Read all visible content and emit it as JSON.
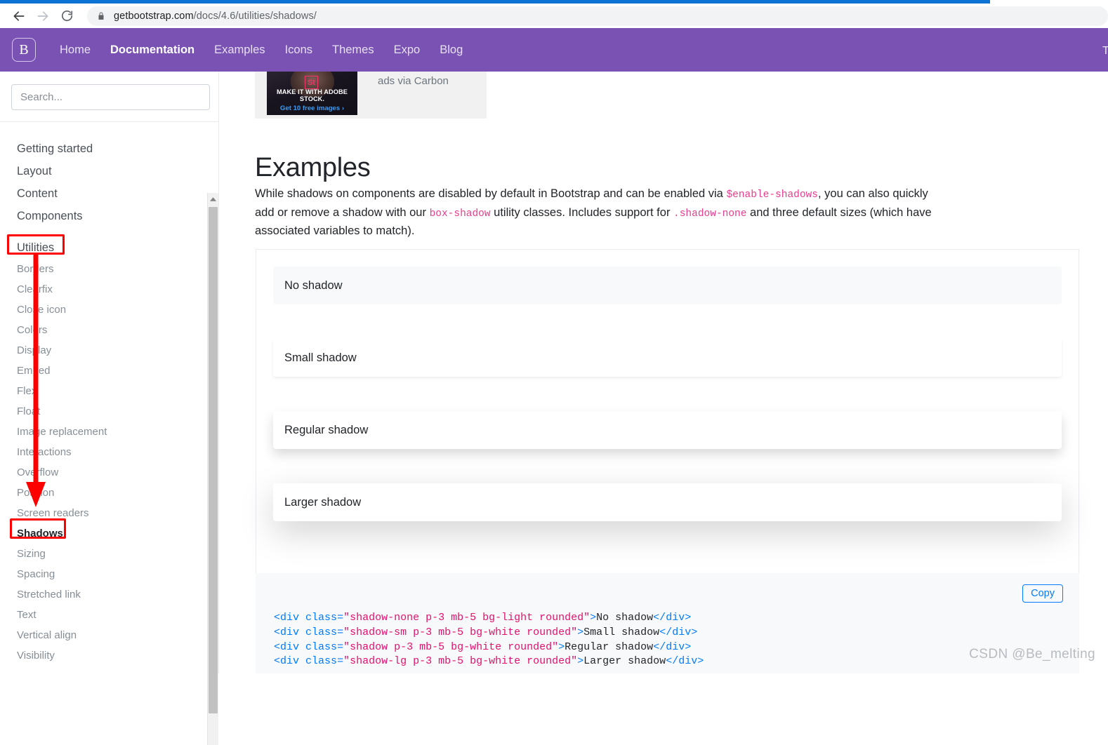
{
  "browser": {
    "back_icon": "arrow-left-icon",
    "forward_icon": "arrow-right-icon",
    "reload_icon": "reload-icon",
    "lock_icon": "lock-icon",
    "url_host": "getbootstrap.com",
    "url_path": "/docs/4.6/utilities/shadows/",
    "tab_strip_color": "#0c72d4"
  },
  "navbar": {
    "brand": "B",
    "brand_color": "#7952b3",
    "links": [
      {
        "label": "Home",
        "active": false
      },
      {
        "label": "Documentation",
        "active": true
      },
      {
        "label": "Examples",
        "active": false
      },
      {
        "label": "Icons",
        "active": false
      },
      {
        "label": "Themes",
        "active": false
      },
      {
        "label": "Expo",
        "active": false
      },
      {
        "label": "Blog",
        "active": false
      }
    ]
  },
  "sidebar": {
    "search_placeholder": "Search...",
    "search_value": "",
    "groups": [
      {
        "label": "Getting started"
      },
      {
        "label": "Layout"
      },
      {
        "label": "Content"
      },
      {
        "label": "Components"
      },
      {
        "label": "Utilities"
      }
    ],
    "utilities_items": [
      {
        "label": "Borders",
        "current": false
      },
      {
        "label": "Clearfix",
        "current": false
      },
      {
        "label": "Close icon",
        "current": false
      },
      {
        "label": "Colors",
        "current": false
      },
      {
        "label": "Display",
        "current": false
      },
      {
        "label": "Embed",
        "current": false
      },
      {
        "label": "Flex",
        "current": false
      },
      {
        "label": "Float",
        "current": false
      },
      {
        "label": "Image replacement",
        "current": false
      },
      {
        "label": "Interactions",
        "current": false
      },
      {
        "label": "Overflow",
        "current": false
      },
      {
        "label": "Position",
        "current": false
      },
      {
        "label": "Screen readers",
        "current": false
      },
      {
        "label": "Shadows",
        "current": true
      },
      {
        "label": "Sizing",
        "current": false
      },
      {
        "label": "Spacing",
        "current": false
      },
      {
        "label": "Stretched link",
        "current": false
      },
      {
        "label": "Text",
        "current": false
      },
      {
        "label": "Vertical align",
        "current": false
      },
      {
        "label": "Visibility",
        "current": false
      }
    ]
  },
  "ad": {
    "headline": "MAKE IT WITH ADOBE STOCK.",
    "cta": "Get 10 free images ›",
    "badge": "St",
    "via": "ads via Carbon"
  },
  "main": {
    "heading": "Examples",
    "paragraph": {
      "part1": "While shadows on components are disabled by default in Bootstrap and can be enabled via ",
      "code1": "$enable-shadows",
      "part2": ", you can also quickly add or remove a shadow with our ",
      "code2": "box-shadow",
      "part3": " utility classes. Includes support for ",
      "code3": ".shadow-none",
      "part4": " and three default sizes (which have associated variables to match)."
    },
    "examples": [
      {
        "label": "No shadow",
        "variant": "sb-none"
      },
      {
        "label": "Small shadow",
        "variant": "sb-sm"
      },
      {
        "label": "Regular shadow",
        "variant": "sb-reg"
      },
      {
        "label": "Larger shadow",
        "variant": "sb-lg"
      }
    ],
    "copy_label": "Copy",
    "code_lines": [
      {
        "cls": "shadow-none p-3 mb-5 bg-light rounded",
        "text": "No shadow"
      },
      {
        "cls": "shadow-sm p-3 mb-5 bg-white rounded",
        "text": "Small shadow"
      },
      {
        "cls": "shadow p-3 mb-5 bg-white rounded",
        "text": "Regular shadow"
      },
      {
        "cls": "shadow-lg p-3 mb-5 bg-white rounded",
        "text": "Larger shadow"
      }
    ]
  },
  "annotations": {
    "color": "#fd0000",
    "boxes": [
      "Utilities",
      "Shadows"
    ],
    "arrow": "down-arrow-annotation"
  },
  "watermark": "CSDN @Be_melting"
}
